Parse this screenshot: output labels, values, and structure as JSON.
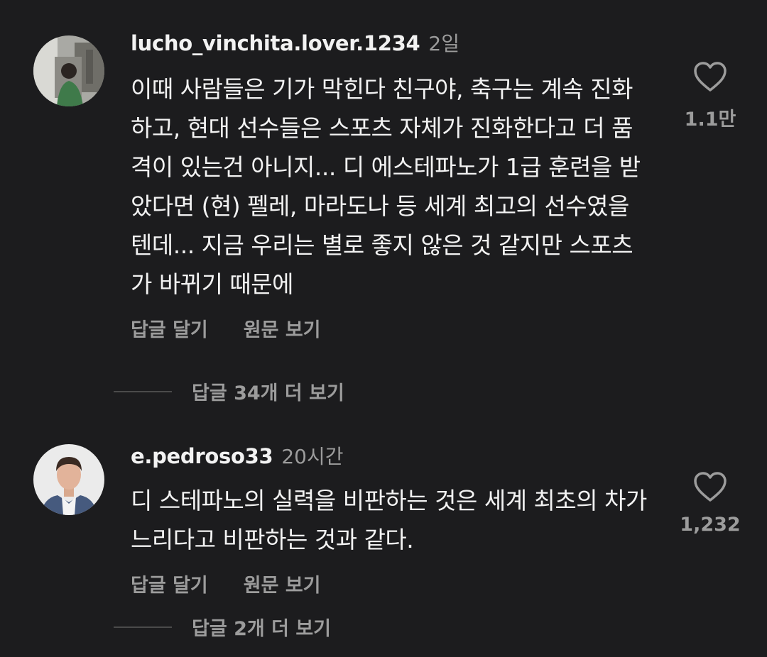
{
  "comments": [
    {
      "username": "lucho_vinchita.lover.1234",
      "time": "2일",
      "text": "이때 사람들은 기가 막힌다 친구야, 축구는 계속 진화하고, 현대 선수들은 스포츠 자체가 진화한다고 더 품격이 있는건 아니지... 디 에스테파노가 1급 훈련을 받았다면 (현) 펠레, 마라도나 등 세계 최고의 선수였을텐데... 지금 우리는 별로 좋지 않은 것 같지만 스포츠가 바뀌기 때문에",
      "reply_label": "답글 달기",
      "original_label": "원문 보기",
      "view_replies": "답글 34개 더 보기",
      "like_count": "1.1만",
      "like_icon": "heart-outline-icon"
    },
    {
      "username": "e.pedroso33",
      "time": "20시간",
      "text": "디 스테파노의 실력을 비판하는 것은 세계 최초의 차가 느리다고 비판하는 것과 같다.",
      "reply_label": "답글 달기",
      "original_label": "원문 보기",
      "view_replies": "답글 2개 더 보기",
      "like_count": "1,232",
      "like_icon": "heart-outline-icon"
    }
  ],
  "colors": {
    "background": "#1c1c1e",
    "primary_text": "#f2f2f2",
    "secondary_text": "#9c9c9c"
  }
}
